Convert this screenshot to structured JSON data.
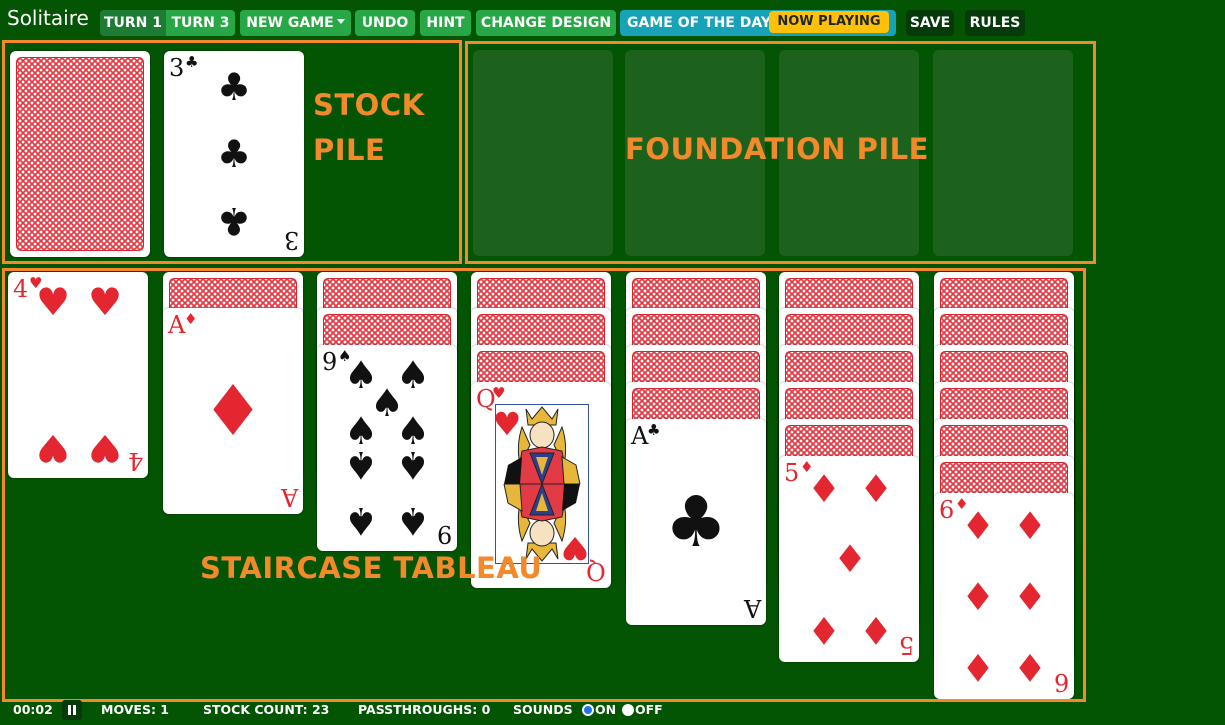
{
  "app": {
    "title": "Solitaire"
  },
  "toolbar": {
    "turn1": "TURN 1",
    "turn3": "TURN 3",
    "new_game": "NEW GAME",
    "undo": "UNDO",
    "hint": "HINT",
    "change_design": "CHANGE DESIGN",
    "game_of_the_day": "GAME OF THE DAY",
    "now_playing": "NOW PLAYING",
    "save": "SAVE",
    "rules": "RULES"
  },
  "annotations": {
    "stock_line1": "STOCK",
    "stock_line2": "PILE",
    "foundation": "FOUNDATION PILE",
    "tableau": "STAIRCASE TABLEAU"
  },
  "stock": {
    "waste_card": {
      "rank": "3",
      "suit": "♣",
      "color": "black"
    }
  },
  "foundation": {
    "slots": 4
  },
  "tableau": [
    {
      "hidden": 0,
      "top": {
        "rank": "4",
        "suit": "♥",
        "color": "red"
      }
    },
    {
      "hidden": 1,
      "top": {
        "rank": "A",
        "suit": "♦",
        "color": "red"
      }
    },
    {
      "hidden": 2,
      "top": {
        "rank": "9",
        "suit": "♠",
        "color": "black"
      }
    },
    {
      "hidden": 3,
      "top": {
        "rank": "Q",
        "suit": "♥",
        "color": "red"
      }
    },
    {
      "hidden": 4,
      "top": {
        "rank": "A",
        "suit": "♣",
        "color": "black"
      }
    },
    {
      "hidden": 5,
      "top": {
        "rank": "5",
        "suit": "♦",
        "color": "red"
      }
    },
    {
      "hidden": 6,
      "top": {
        "rank": "6",
        "suit": "♦",
        "color": "red"
      }
    }
  ],
  "status": {
    "time": "00:02",
    "moves": "MOVES: 1",
    "stock_count": "STOCK COUNT: 23",
    "passthroughs": "PASSTHROUGHS: 0",
    "sounds": "SOUNDS",
    "on": "ON",
    "off": "OFF"
  },
  "colors": {
    "table_green": "#035503",
    "button_green": "#27a745",
    "annotation_orange": "#f28a2c",
    "card_red": "#e3262f",
    "info_teal": "#17a2b8",
    "badge_yellow": "#ffc107"
  }
}
